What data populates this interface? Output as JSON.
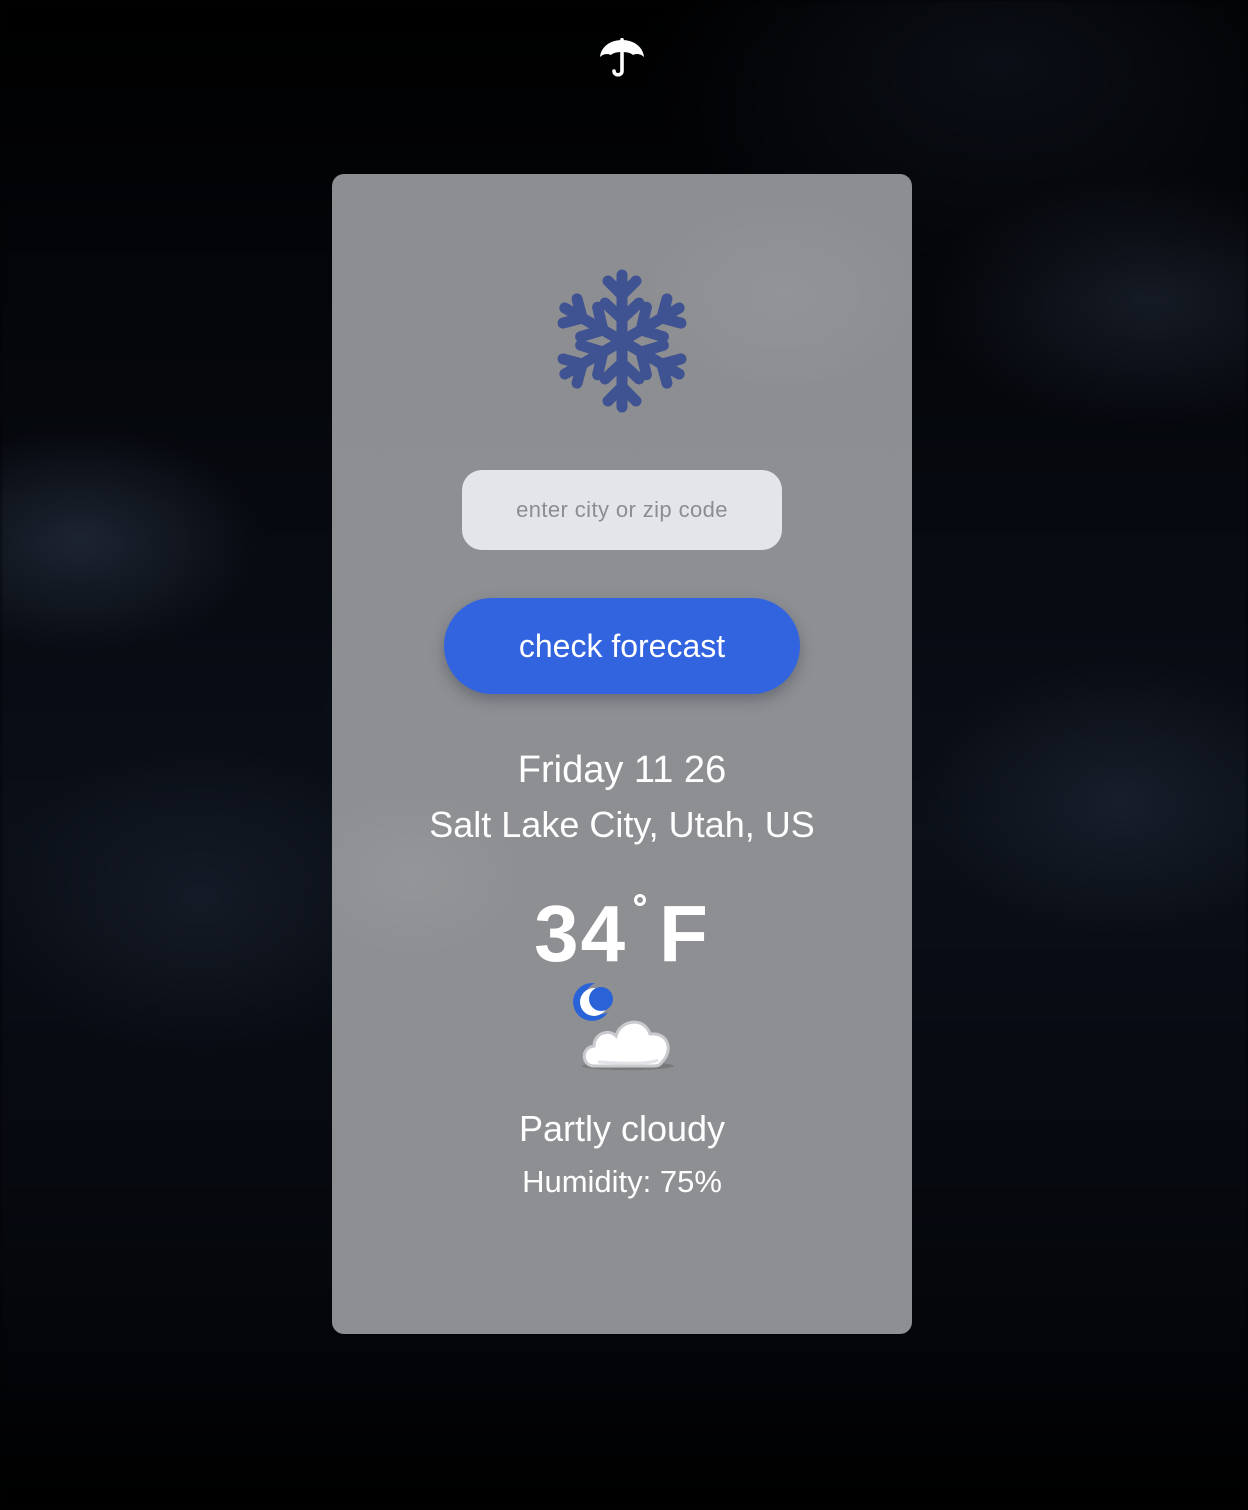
{
  "header": {
    "logo_icon": "umbrella-icon"
  },
  "hero": {
    "icon": "snowflake-icon",
    "icon_color": "#3f5291"
  },
  "search": {
    "placeholder": "enter city or zip code",
    "value": ""
  },
  "action": {
    "label": "check forecast",
    "color": "#3364e0"
  },
  "weather": {
    "date": "Friday 11 26",
    "location": "Salt Lake City, Utah, US",
    "temperature": "34",
    "degree_symbol": "˚",
    "unit": "F",
    "condition_icon": "moon-cloud-icon",
    "condition": "Partly cloudy",
    "humidity": "Humidity: 75%"
  }
}
